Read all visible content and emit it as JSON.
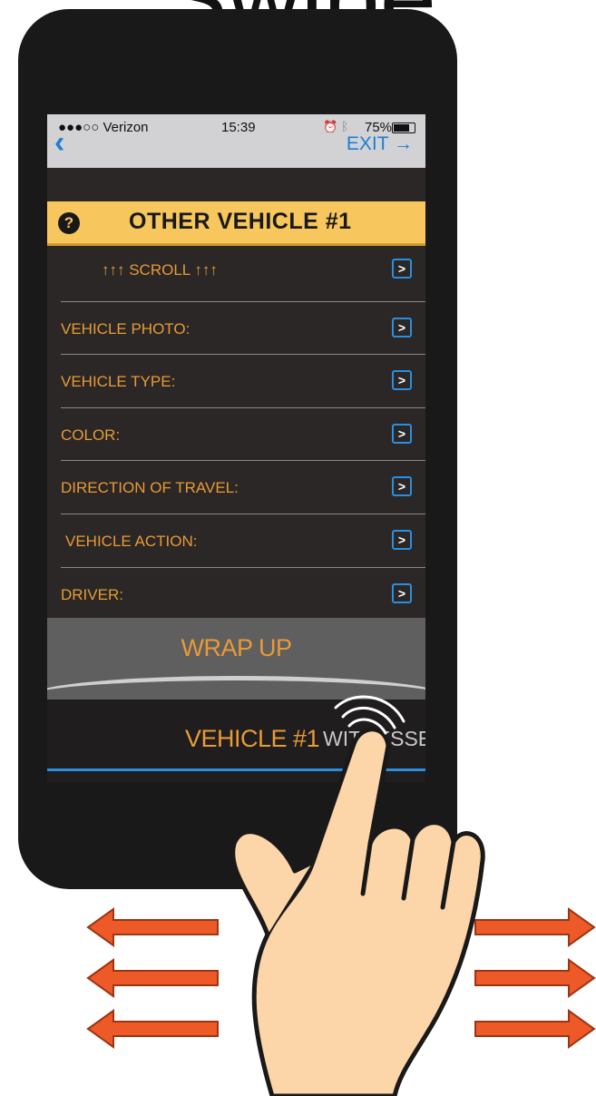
{
  "heading": "Swipe",
  "statusbar": {
    "carrier": "●●●○○ Verizon",
    "time": "15:39",
    "battery": "75%"
  },
  "nav": {
    "back_icon": "chevron-left-icon",
    "exit_label": "EXIT →"
  },
  "banner": {
    "help_icon": "?",
    "title": "OTHER VEHICLE #1"
  },
  "rows": [
    {
      "label": "↑↑↑    SCROLL    ↑↑↑"
    },
    {
      "label": "VEHICLE PHOTO:"
    },
    {
      "label": "VEHICLE TYPE:"
    },
    {
      "label": "COLOR:"
    },
    {
      "label": "DIRECTION OF TRAVEL:"
    },
    {
      "label": "VEHICLE ACTION:"
    },
    {
      "label": "DRIVER:"
    }
  ],
  "row_arrow": ">",
  "wrapup_label": "WRAP UP",
  "tabs": {
    "active": "VEHICLE #1",
    "next": "WITNESSES"
  },
  "colors": {
    "accent_orange": "#e89a37",
    "banner_yellow": "#f7c65d",
    "ios_blue": "#1c7fd6",
    "swipe_arrow": "#ee5a27"
  }
}
